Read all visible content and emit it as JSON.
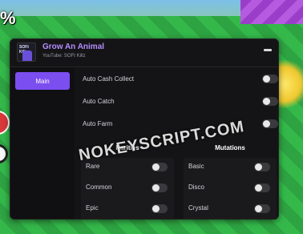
{
  "hud": {
    "percent": "%"
  },
  "header": {
    "title": "Grow An Animal",
    "subtitle": "YouTube: SOFt Killz",
    "logo_text": "SOFt Killz"
  },
  "sidebar": {
    "tabs": [
      {
        "label": "Main"
      }
    ]
  },
  "main": {
    "toggles": [
      {
        "label": "Auto Cash Collect",
        "on": false
      },
      {
        "label": "Auto Catch",
        "on": false
      },
      {
        "label": "Auto Farm",
        "on": false
      }
    ]
  },
  "rarities": {
    "title": "Rarities",
    "items": [
      {
        "label": "Rare",
        "on": false
      },
      {
        "label": "Common",
        "on": false
      },
      {
        "label": "Epic",
        "on": false
      }
    ]
  },
  "mutations": {
    "title": "Mutations",
    "items": [
      {
        "label": "Basic",
        "on": false
      },
      {
        "label": "Disco",
        "on": false
      },
      {
        "label": "Crystal",
        "on": false
      }
    ]
  },
  "watermark": "NOKEYSCRIPT.COM",
  "colors": {
    "accent": "#7b4ef0",
    "title": "#b58cff",
    "panel": "#141416"
  }
}
